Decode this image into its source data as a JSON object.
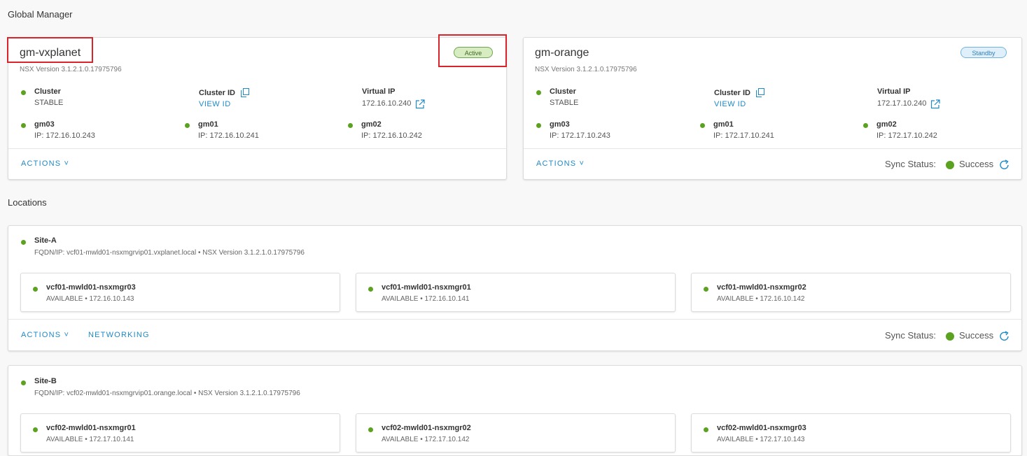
{
  "global_manager": {
    "title": "Global Manager",
    "managers": [
      {
        "name": "gm-vxplanet",
        "version": "NSX Version  3.1.2.1.0.17975796",
        "status": "Active",
        "cluster_label": "Cluster",
        "cluster_status": "STABLE",
        "cluster_id_label": "Cluster ID",
        "view_id": "VIEW ID",
        "virtual_ip_label": "Virtual IP",
        "virtual_ip": "172.16.10.240",
        "nodes": [
          {
            "name": "gm03",
            "ip": "IP: 172.16.10.243"
          },
          {
            "name": "gm01",
            "ip": "IP: 172.16.10.241"
          },
          {
            "name": "gm02",
            "ip": "IP: 172.16.10.242"
          }
        ],
        "actions": "ACTIONS ˅"
      },
      {
        "name": "gm-orange",
        "version": "NSX Version  3.1.2.1.0.17975796",
        "status": "Standby",
        "cluster_label": "Cluster",
        "cluster_status": "STABLE",
        "cluster_id_label": "Cluster ID",
        "view_id": "VIEW ID",
        "virtual_ip_label": "Virtual IP",
        "virtual_ip": "172.17.10.240",
        "nodes": [
          {
            "name": "gm03",
            "ip": "IP: 172.17.10.243"
          },
          {
            "name": "gm01",
            "ip": "IP: 172.17.10.241"
          },
          {
            "name": "gm02",
            "ip": "IP: 172.17.10.242"
          }
        ],
        "actions": "ACTIONS ˅",
        "sync_label": "Sync Status:",
        "sync_value": "Success"
      }
    ]
  },
  "locations": {
    "title": "Locations",
    "sites": [
      {
        "name": "Site-A",
        "fqdn": "FQDN/IP: vcf01-mwld01-nsxmgrvip01.vxplanet.local • NSX Version 3.1.2.1.0.17975796",
        "nodes": [
          {
            "name": "vcf01-mwld01-nsxmgr03",
            "status": "AVAILABLE • 172.16.10.143"
          },
          {
            "name": "vcf01-mwld01-nsxmgr01",
            "status": "AVAILABLE • 172.16.10.141"
          },
          {
            "name": "vcf01-mwld01-nsxmgr02",
            "status": "AVAILABLE • 172.16.10.142"
          }
        ],
        "actions": "ACTIONS ˅",
        "networking": "NETWORKING",
        "sync_label": "Sync Status:",
        "sync_value": "Success"
      },
      {
        "name": "Site-B",
        "fqdn": "FQDN/IP: vcf02-mwld01-nsxmgrvip01.orange.local • NSX Version 3.1.2.1.0.17975796",
        "nodes": [
          {
            "name": "vcf02-mwld01-nsxmgr01",
            "status": "AVAILABLE • 172.17.10.141"
          },
          {
            "name": "vcf02-mwld01-nsxmgr02",
            "status": "AVAILABLE • 172.17.10.142"
          },
          {
            "name": "vcf02-mwld01-nsxmgr03",
            "status": "AVAILABLE • 172.17.10.143"
          }
        ]
      }
    ]
  },
  "colors": {
    "accent_link": "#1f89c7",
    "status_green": "#5aa220",
    "highlight_red": "#d9242c"
  }
}
